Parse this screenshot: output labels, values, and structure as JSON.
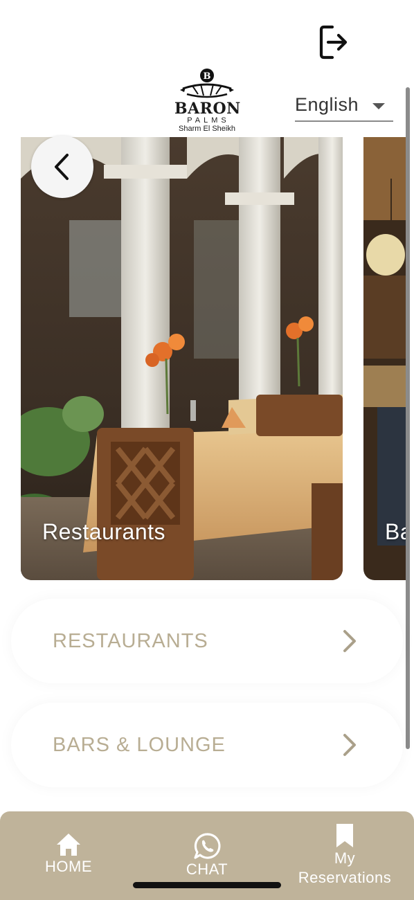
{
  "header": {
    "logo": {
      "brand": "BARON",
      "sub": "PALMS",
      "location": "Sharm El Sheikh"
    },
    "language": {
      "selected": "English"
    },
    "icons": {
      "logout": "logout-icon",
      "chevron_down": "chevron-down-icon"
    }
  },
  "gallery": {
    "cards": [
      {
        "label": "Restaurants"
      },
      {
        "label": "Ba"
      }
    ],
    "back_icon": "chevron-left-icon"
  },
  "categories": [
    {
      "label": "RESTAURANTS",
      "icon": "chevron-right-icon"
    },
    {
      "label": "BARS & LOUNGE",
      "icon": "chevron-right-icon"
    }
  ],
  "bottom_nav": {
    "items": [
      {
        "label": "HOME",
        "icon": "home-icon"
      },
      {
        "label": "CHAT",
        "icon": "whatsapp-icon"
      },
      {
        "label": "My Reservations",
        "icon": "bookmark-icon"
      }
    ]
  },
  "colors": {
    "accent": "#bfb39a",
    "category_text": "#b8ad93",
    "background": "#ffffff"
  }
}
